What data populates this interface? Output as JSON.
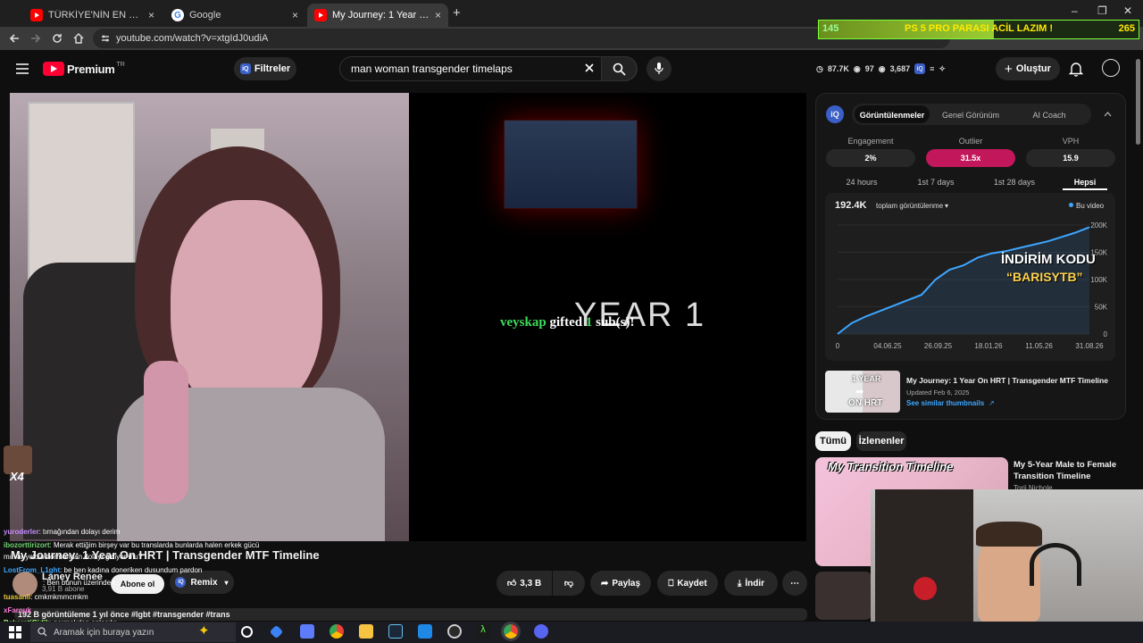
{
  "browser": {
    "tabs": [
      {
        "title": "TÜRKİYE'NİN EN UCUZ TAVUK",
        "close": "×"
      },
      {
        "title": "Google",
        "close": "×"
      },
      {
        "title": "My Journey: 1 Year On HRT | Tra",
        "close": "×"
      }
    ],
    "new_tab": "+",
    "window_controls": {
      "min": "–",
      "restore": "❐",
      "close": "✕"
    },
    "url": "youtube.com/watch?v=xtgIdJ0udiA"
  },
  "overlay_bar": {
    "left_value": "145",
    "center_text": "PS 5 PRO PARASI ACİL LAZIM !",
    "right_value": "265",
    "progress": 0.547
  },
  "youtube": {
    "premium_label": "Premium",
    "premium_region": "TR",
    "filter_label": "Filtreler",
    "search_query": "man woman transgender timelaps",
    "header_stats": {
      "a": "87.7K",
      "b": "97",
      "c": "3,687"
    },
    "create_label": "Oluştur"
  },
  "video": {
    "overlay_title": "YEAR 1",
    "gift_user": "veyskap",
    "gift_text_a": "gifted",
    "gift_count": "1",
    "gift_text_b": "sub(s)!",
    "sticker_left": "X4"
  },
  "panel": {
    "tabs": [
      "Görüntülenmeler",
      "Genel Görünüm",
      "AI Coach"
    ],
    "metrics": [
      {
        "label": "Engagement",
        "value": "2%"
      },
      {
        "label": "Outlier",
        "value": "31.5x"
      },
      {
        "label": "VPH",
        "value": "15.9"
      }
    ],
    "ranges": [
      "24 hours",
      "1st 7 days",
      "1st 28 days",
      "Hepsi"
    ],
    "total_views": "192.4K",
    "total_label": "toplam görüntülenme",
    "legend": "Bu video",
    "promo_line1": "İNDİRİM KODU",
    "promo_line2": "“BARISYTB”",
    "video_title": "My Journey: 1 Year On HRT | Transgender MTF Timeline",
    "updated": "Updated Feb 6, 2025",
    "similar_link": "See similar thumbnails",
    "thumb_text_a": "1 YEAR",
    "thumb_text_b": "ON HRT"
  },
  "chart_data": {
    "type": "area",
    "x": [
      "04.06.25",
      "26.09.25",
      "18.01.26",
      "11.05.26",
      "31.08.26"
    ],
    "x_first_tick": "0",
    "y_ticks": [
      "200K",
      "150K",
      "100K",
      "50K",
      "0"
    ],
    "ylim": [
      0,
      200000
    ],
    "series": [
      {
        "values": [
          0,
          20000,
          32000,
          42000,
          52000,
          62000,
          72000,
          100000,
          118000,
          126000,
          140000,
          148000,
          152000,
          158000,
          164000,
          170000,
          178000,
          186000,
          196000
        ]
      }
    ]
  },
  "chips": [
    "Tümü",
    "İzlenenler"
  ],
  "recommended": [
    {
      "title": "My 5-Year Male to Female Transition Timeline",
      "channel": "Torii Nichole",
      "thumb_text": "My Transition Timeline"
    }
  ],
  "below_video": {
    "title": "My Journey: 1 Year On HRT | Transgender MTF Timeline",
    "channel": "Laney Renee",
    "subs": "3,91 B abone",
    "subscribe": "Abone ol",
    "remix": "Remix",
    "likes": "3,3 B",
    "share": "Paylaş",
    "save": "Kaydet",
    "download": "İndir",
    "meta": "192 B görüntüleme  1 yıl önce  #lgbt #transgender #trans"
  },
  "chat": [
    {
      "user": "yuroderler",
      "text": ": tırnağından dolayı derim"
    },
    {
      "user": "ibozorttirizort",
      "text": ": Merak ettiğim birşey var bu translarda bunlarda halen erkek gücü"
    },
    {
      "user": "",
      "text": "mı var yoksa hormondan dolayı gidiyor mu?"
    },
    {
      "user": "LostFrom_L1ght",
      "text": ": be ben kadına doneriken dusundum pardon"
    },
    {
      "user": "",
      "text": ": Ben bunun üzerinden..."
    },
    {
      "user": "tuasanli",
      "text": ": cmkmkmmcmkm"
    },
    {
      "user": "xFarouk",
      "text": ""
    },
    {
      "user": "BekaretiGidik",
      "text": ": parmakdan anlaşılır"
    }
  ],
  "taskbar": {
    "search_placeholder": "Aramak için buraya yazın"
  },
  "colors": {
    "accent": "#ff0033",
    "outlier": "#c2185b",
    "chart_line": "#3ea6ff",
    "link": "#3ea6ff"
  }
}
